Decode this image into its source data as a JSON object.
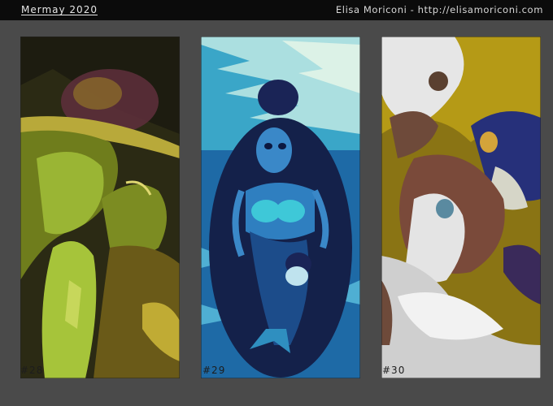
{
  "header": {
    "title": "Mermay 2020",
    "credit": "Elisa Moriconi - http://elisamoriconi.com"
  },
  "artworks": [
    {
      "caption": "#28"
    },
    {
      "caption": "#29"
    },
    {
      "caption": "#30"
    }
  ],
  "colors": {
    "background": "#4a4a4a",
    "topbar": "#0b0b0b",
    "panel28_accent": "#a6c43a",
    "panel29_accent": "#3ec8d8",
    "panel30_accent": "#b59a16"
  }
}
